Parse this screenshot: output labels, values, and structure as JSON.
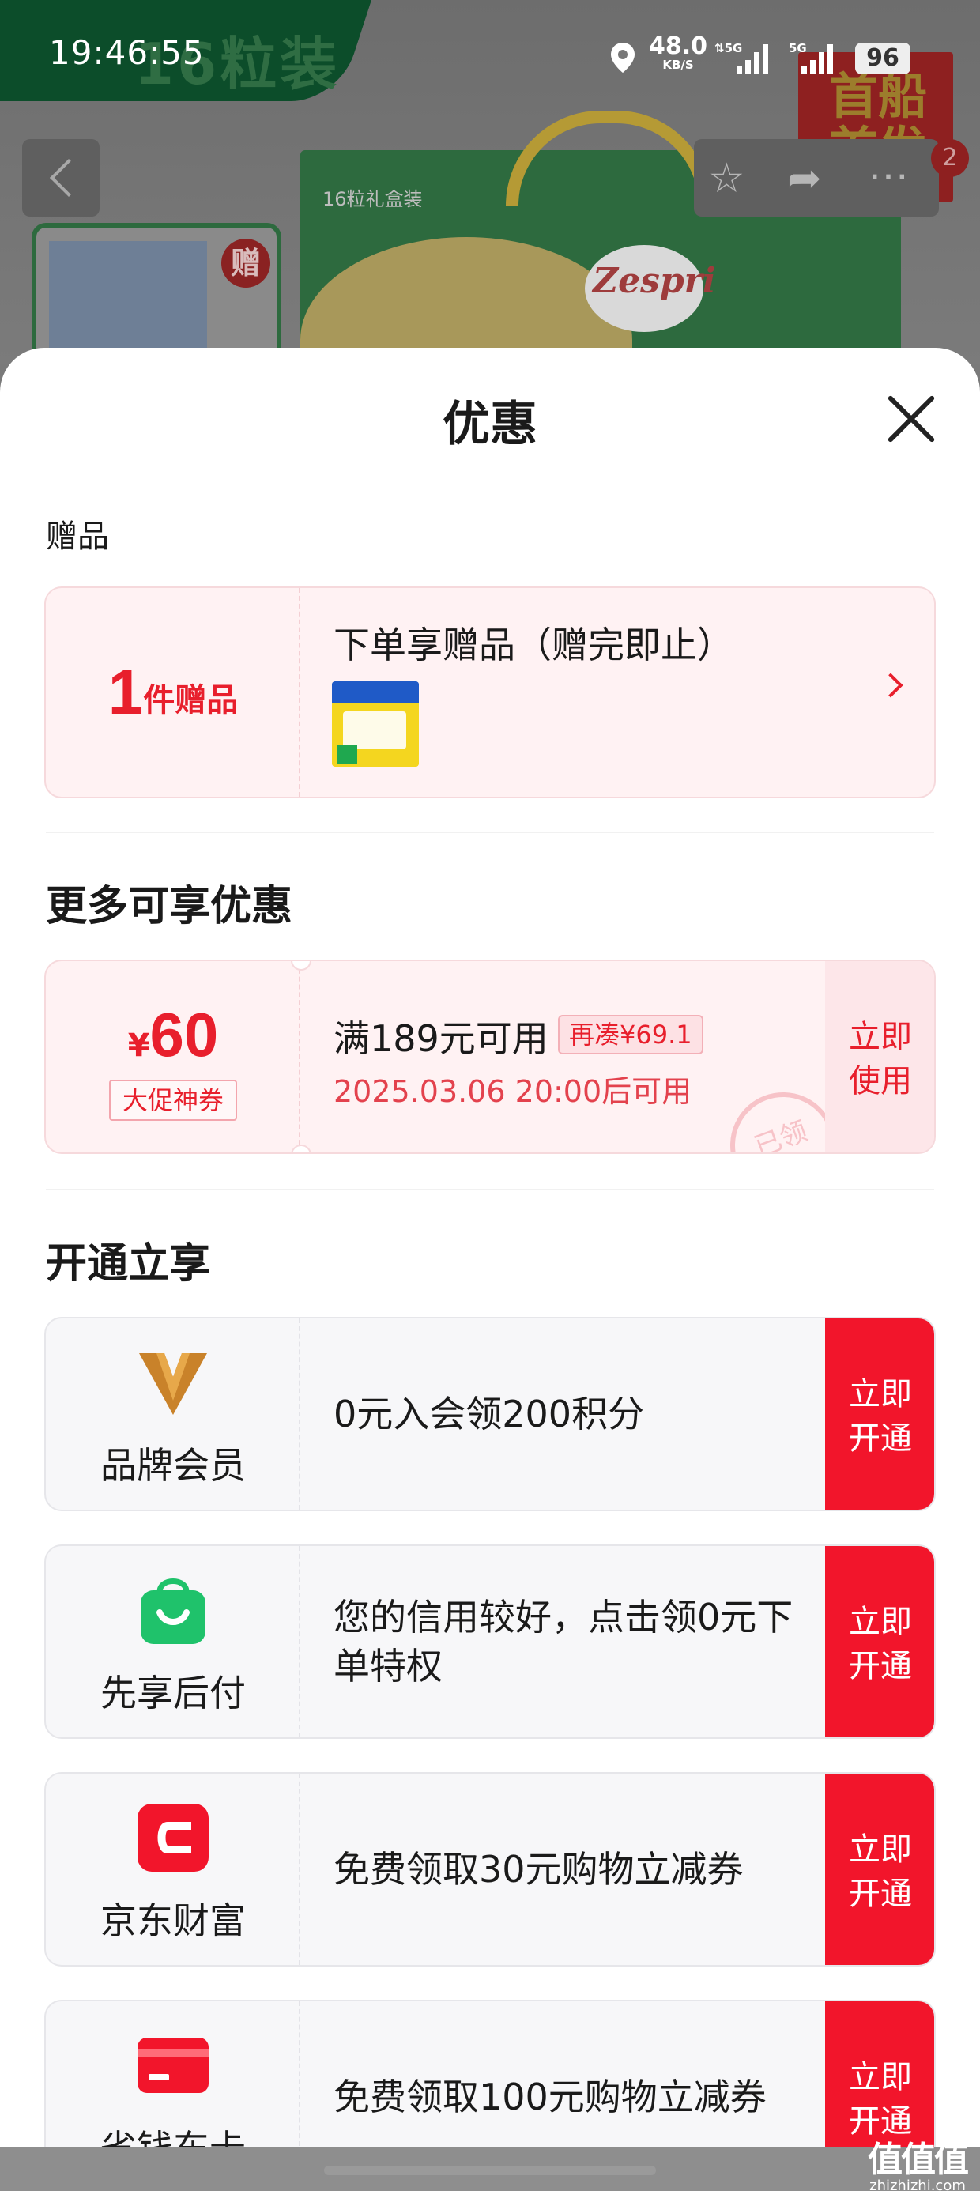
{
  "status_bar": {
    "time": "19:46:55",
    "net_speed_value": "48.0",
    "net_speed_unit": "KB/S",
    "signal1_label": "5G",
    "signal2_label": "5G",
    "battery": "96"
  },
  "background_page": {
    "tab_text": "16粒装",
    "box_label": "16粒礼盒装",
    "brand_logo": "Zespri",
    "gift_badge": "赠",
    "promo_badge": "首船首发",
    "cart_count": "2"
  },
  "sheet": {
    "title": "优惠",
    "gift_section": {
      "label": "赠品",
      "count_num": "1",
      "count_unit": "件赠品",
      "title": "下单享赠品（赠完即止）"
    },
    "more_section": {
      "heading": "更多可享优惠",
      "coupon": {
        "currency": "¥",
        "amount": "60",
        "tag": "大促神券",
        "condition": "满189元可用",
        "need_more": "再凑¥69.1",
        "valid_time": "2025.03.06 20:00后可用",
        "stamp": "已领",
        "button_line1": "立即",
        "button_line2": "使用"
      }
    },
    "open_section": {
      "heading": "开通立享",
      "items": [
        {
          "name": "品牌会员",
          "icon": "brand-v-icon",
          "desc": "0元入会领200积分",
          "btn1": "立即",
          "btn2": "开通"
        },
        {
          "name": "先享后付",
          "icon": "shopping-bag-icon",
          "desc": "您的信用较好，点击领0元下单特权",
          "btn1": "立即",
          "btn2": "开通"
        },
        {
          "name": "京东财富",
          "icon": "jd-wealth-icon",
          "desc": "免费领取30元购物立减券",
          "btn1": "立即",
          "btn2": "开通"
        },
        {
          "name": "省钱东卡",
          "icon": "card-icon",
          "desc": "免费领取100元购物立减券",
          "btn1": "立即",
          "btn2": "开通"
        }
      ]
    }
  },
  "watermark": {
    "logo": "值值值",
    "url": "zhizhizhi.com"
  },
  "colors": {
    "accent_red": "#e81f2c",
    "button_red": "#f2152b",
    "coupon_bg": "#fff2f3",
    "card_bg": "#f7f7f9",
    "pay_green": "#1fc26b",
    "brand_orange": "#c9822a"
  }
}
